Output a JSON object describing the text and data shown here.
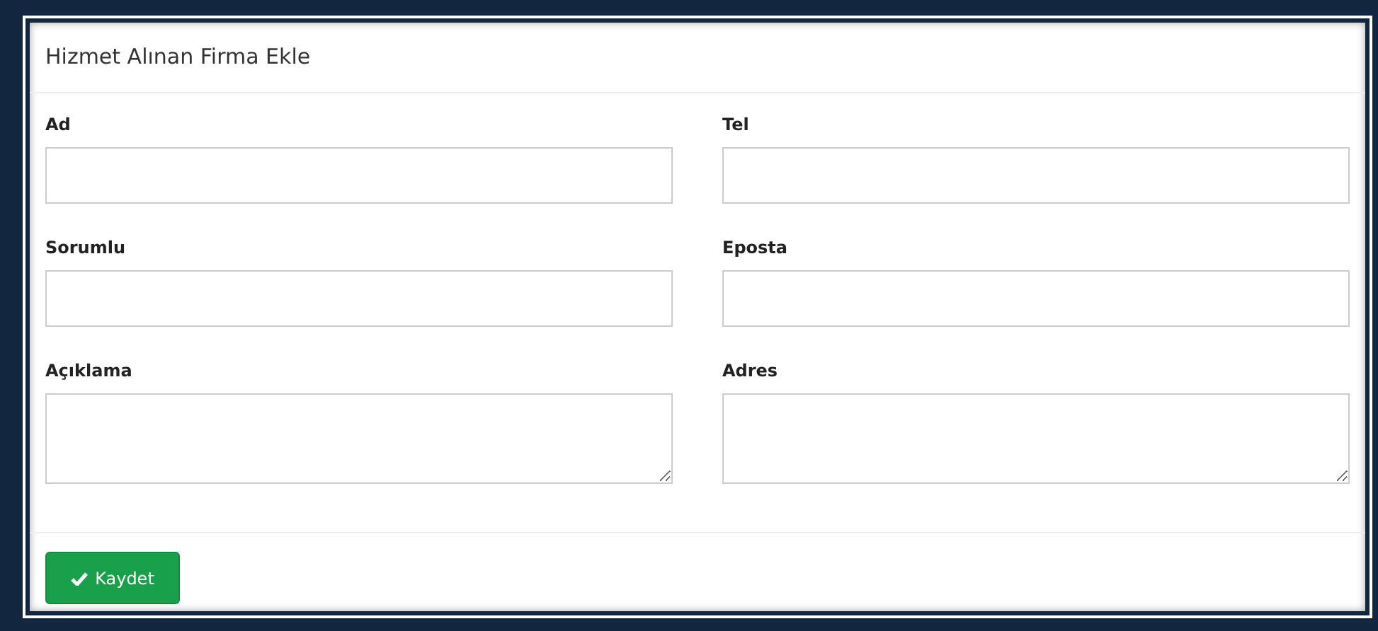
{
  "panel": {
    "title": "Hizmet Alınan Firma Ekle"
  },
  "fields": [
    {
      "label": "Ad",
      "kind": "input"
    },
    {
      "label": "Tel",
      "kind": "input"
    },
    {
      "label": "Sorumlu",
      "kind": "input"
    },
    {
      "label": "Eposta",
      "kind": "input"
    },
    {
      "label": "Açıklama",
      "kind": "textarea"
    },
    {
      "label": "Adres",
      "kind": "textarea"
    }
  ],
  "save_button": {
    "label": "Kaydet"
  }
}
